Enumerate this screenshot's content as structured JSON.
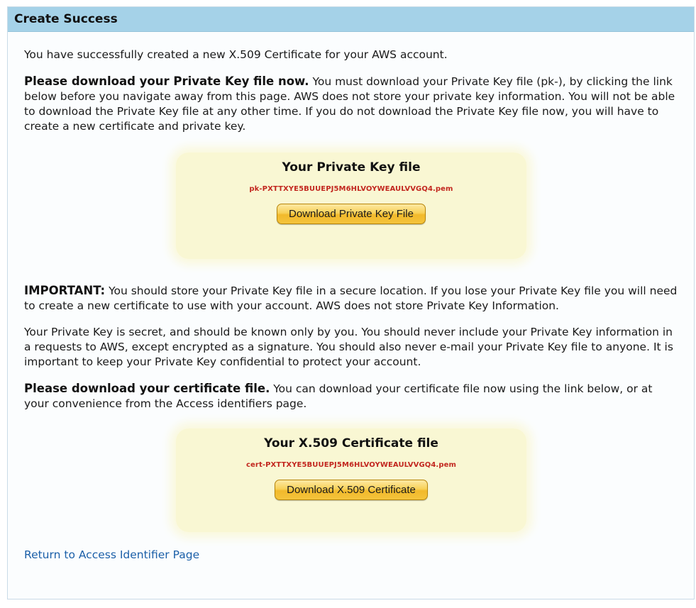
{
  "panel": {
    "title": "Create Success"
  },
  "intro": "You have successfully created a new X.509 Certificate for your AWS account.",
  "private_key_notice": {
    "bold": "Please download your Private Key file now.",
    "text": " You must download your Private Key file (pk-), by clicking the link below before you navigate away from this page. AWS does not store your private key information. You will not be able to download the Private Key file at any other time. If you do not download the Private Key file now, you will have to create a new certificate and private key."
  },
  "private_key_box": {
    "title": "Your Private Key file",
    "file_name": "pk-PXTTXYE5BUUEPJ5M6HLVOYWEAULVVGQ4.pem",
    "button_label": "Download Private Key File"
  },
  "important_notice": {
    "bold": "IMPORTANT:",
    "text": " You should store your Private Key file in a secure location. If you lose your Private Key file you will need to create a new certificate to use with your account. AWS does not store Private Key Information."
  },
  "secret_notice": "Your Private Key is secret, and should be known only by you. You should never include your Private Key information in a requests to AWS, except encrypted as a signature. You should also never e-mail your Private Key file to anyone. It is important to keep your Private Key confidential to protect your account.",
  "certificate_notice": {
    "bold": "Please download your certificate file.",
    "text": " You can download your certificate file now using the link below, or at your convenience from the Access identifiers page."
  },
  "certificate_box": {
    "title": "Your X.509 Certificate file",
    "file_name": "cert-PXTTXYE5BUUEPJ5M6HLVOYWEAULVVGQ4.pem",
    "button_label": "Download X.509 Certificate"
  },
  "return_link": "Return to Access Identifier Page",
  "colors": {
    "header_bg": "#a5d2e8",
    "box_bg": "#f9f7d3",
    "file_name": "#c2271f",
    "link": "#1b5fa8",
    "button": "#f8d158"
  }
}
